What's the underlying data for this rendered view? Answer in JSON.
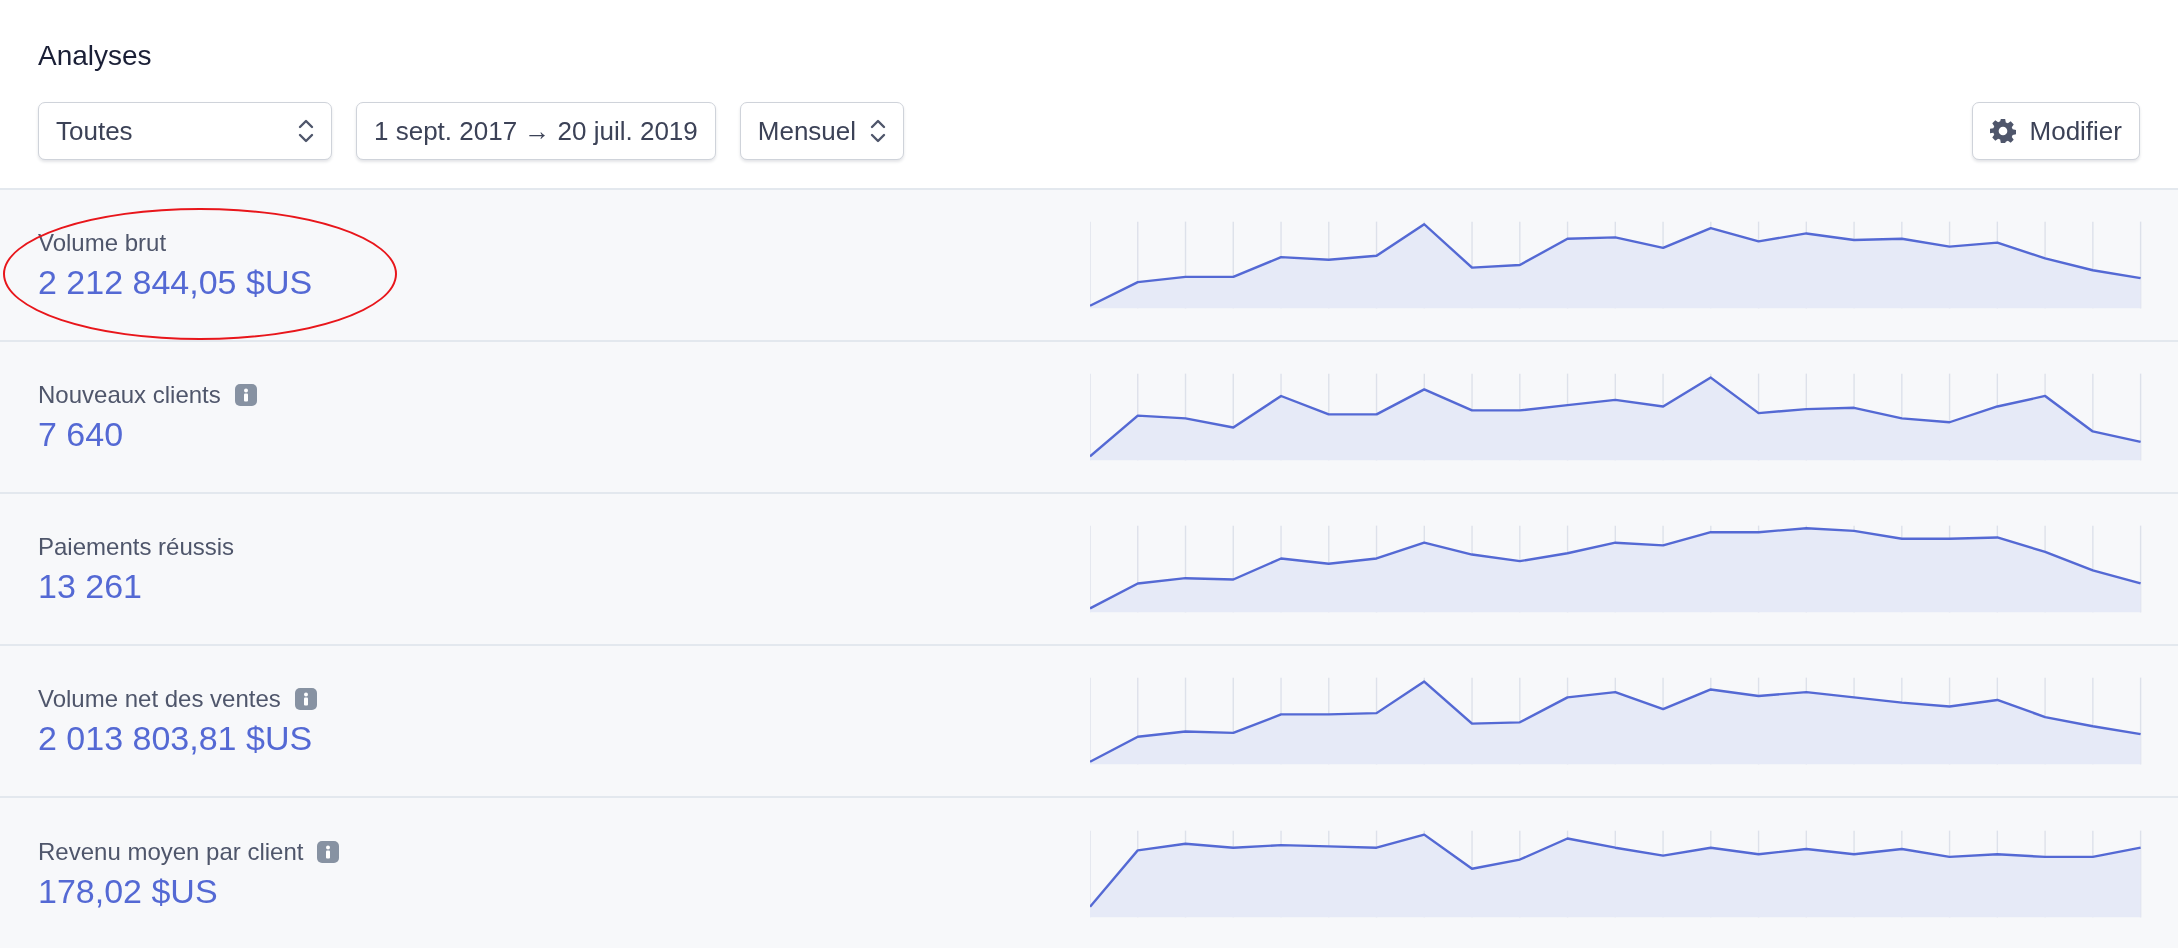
{
  "title": "Analyses",
  "filters": [
    {
      "kind": "select",
      "value": "Toutes"
    },
    {
      "kind": "range",
      "value": "1 sept. 2017 → 20 juil. 2019"
    },
    {
      "kind": "select",
      "value": "Mensuel"
    }
  ],
  "edit_button": {
    "label": "Modifier"
  },
  "metrics": [
    {
      "label": "Volume brut",
      "value": "2 212 844,05 $US",
      "info": false,
      "highlighted": true
    },
    {
      "label": "Nouveaux clients",
      "value": "7 640",
      "info": true,
      "highlighted": false
    },
    {
      "label": "Paiements réussis",
      "value": "13 261",
      "info": false,
      "highlighted": false
    },
    {
      "label": "Volume net des ventes",
      "value": "2 013 803,81 $US",
      "info": true,
      "highlighted": false
    },
    {
      "label": "Revenu moyen par client",
      "value": "178,02 $US",
      "info": true,
      "highlighted": false
    }
  ]
}
